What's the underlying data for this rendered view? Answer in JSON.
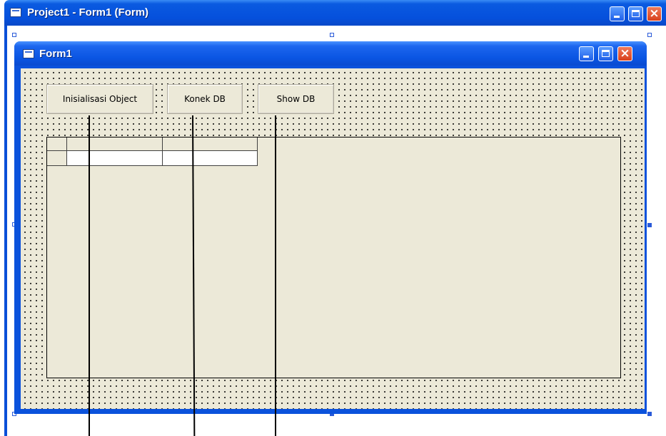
{
  "outer_window": {
    "title": "Project1 - Form1 (Form)"
  },
  "form_window": {
    "title": "Form1"
  },
  "buttons": {
    "init_label": "Inisialisasi Object",
    "connect_label": "Konek DB",
    "show_label": "Show DB"
  },
  "colors": {
    "titlebar_blue": "#0a55e2",
    "form_face": "#ece9d8",
    "close_red": "#d8401c"
  }
}
